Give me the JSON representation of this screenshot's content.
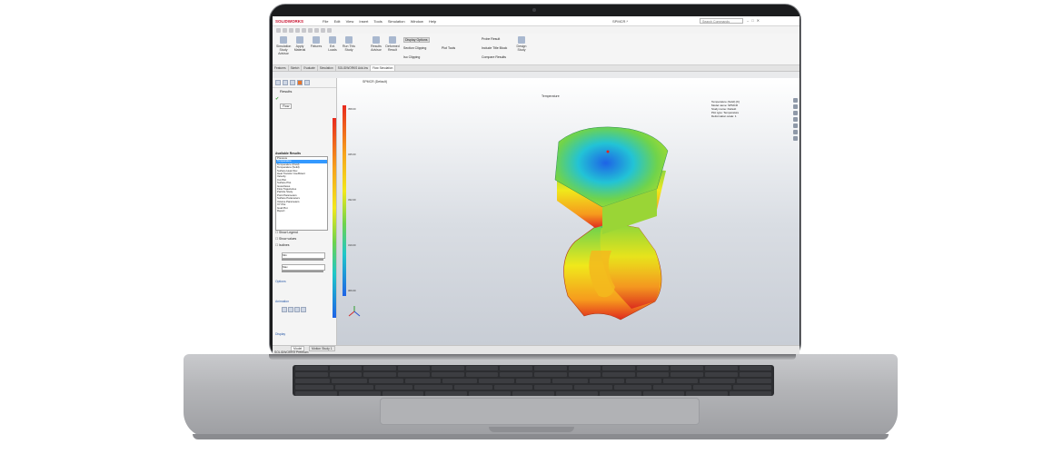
{
  "app": {
    "logo": "SOLIDWORKS",
    "document_title": "SPMCR.*",
    "search_placeholder": "Search Commands",
    "menu": [
      "File",
      "Edit",
      "View",
      "Insert",
      "Tools",
      "Simulation",
      "Window",
      "Help"
    ]
  },
  "ribbon": {
    "buttons": [
      "Simulation Study Advisor",
      "Apply Material",
      "Fixtures",
      "Ext. Loads",
      "Run This Study",
      "Results Advisor",
      "Deformed Result",
      "Compare Results",
      "Design Study",
      "Report"
    ],
    "options": [
      "Display Options",
      "Section Clipping",
      "Iso Clipping",
      "Plot Tools",
      "Probe Result",
      "Include Title Block",
      "Compare Results"
    ],
    "selected_option": "Display Options"
  },
  "tabs": [
    "Features",
    "Sketch",
    "Evaluate",
    "Simulation",
    "SOLIDWORKS Add-Ins",
    "Flow Simulation"
  ],
  "panel": {
    "title": "Results",
    "subtab": "Flow",
    "section_label": "Available Results",
    "results_list": [
      "Pressure",
      "Temperature",
      "Temperature (Fluid)",
      "Temperature (Solid)",
      "Surface Heat Flux",
      "Heat Transfer Coefficient",
      "Velocity",
      "Cut Plot",
      "Surface Plot",
      "Isosurfaces",
      "Flow Trajectories",
      "Particle Study",
      "Point Parameters",
      "Surface Parameters",
      "Volume Parameters",
      "XY Plot",
      "Goal Plot",
      "Report"
    ],
    "selected_result": "Temperature",
    "checkboxes": [
      "Show Legend",
      "Show values",
      "Isolines"
    ],
    "min_label": "Min",
    "max_label": "Max",
    "section_options": "Options",
    "section_animation": "Animation",
    "section_display": "Display"
  },
  "viewport": {
    "study_title": "SPMCR (Default)",
    "plot_title": "Temperature",
    "scale_values": [
      "358.00",
      "345.00",
      "332.00",
      "319.00",
      "306.00"
    ],
    "info_lines": [
      "Temperature (Solid) [K]",
      "Model name: SPMCR",
      "Study name: Default",
      "Plot type: Temperature",
      "Deformation scale: 1"
    ]
  },
  "status": {
    "left": "SOLIDWORKS Premium",
    "bottom_tabs": [
      "Model",
      "Motion Study 1"
    ]
  },
  "colors": {
    "accent": "#c8102e",
    "hot": "#e82a1e",
    "cold": "#1e63e6",
    "check": "#5ec24e"
  }
}
